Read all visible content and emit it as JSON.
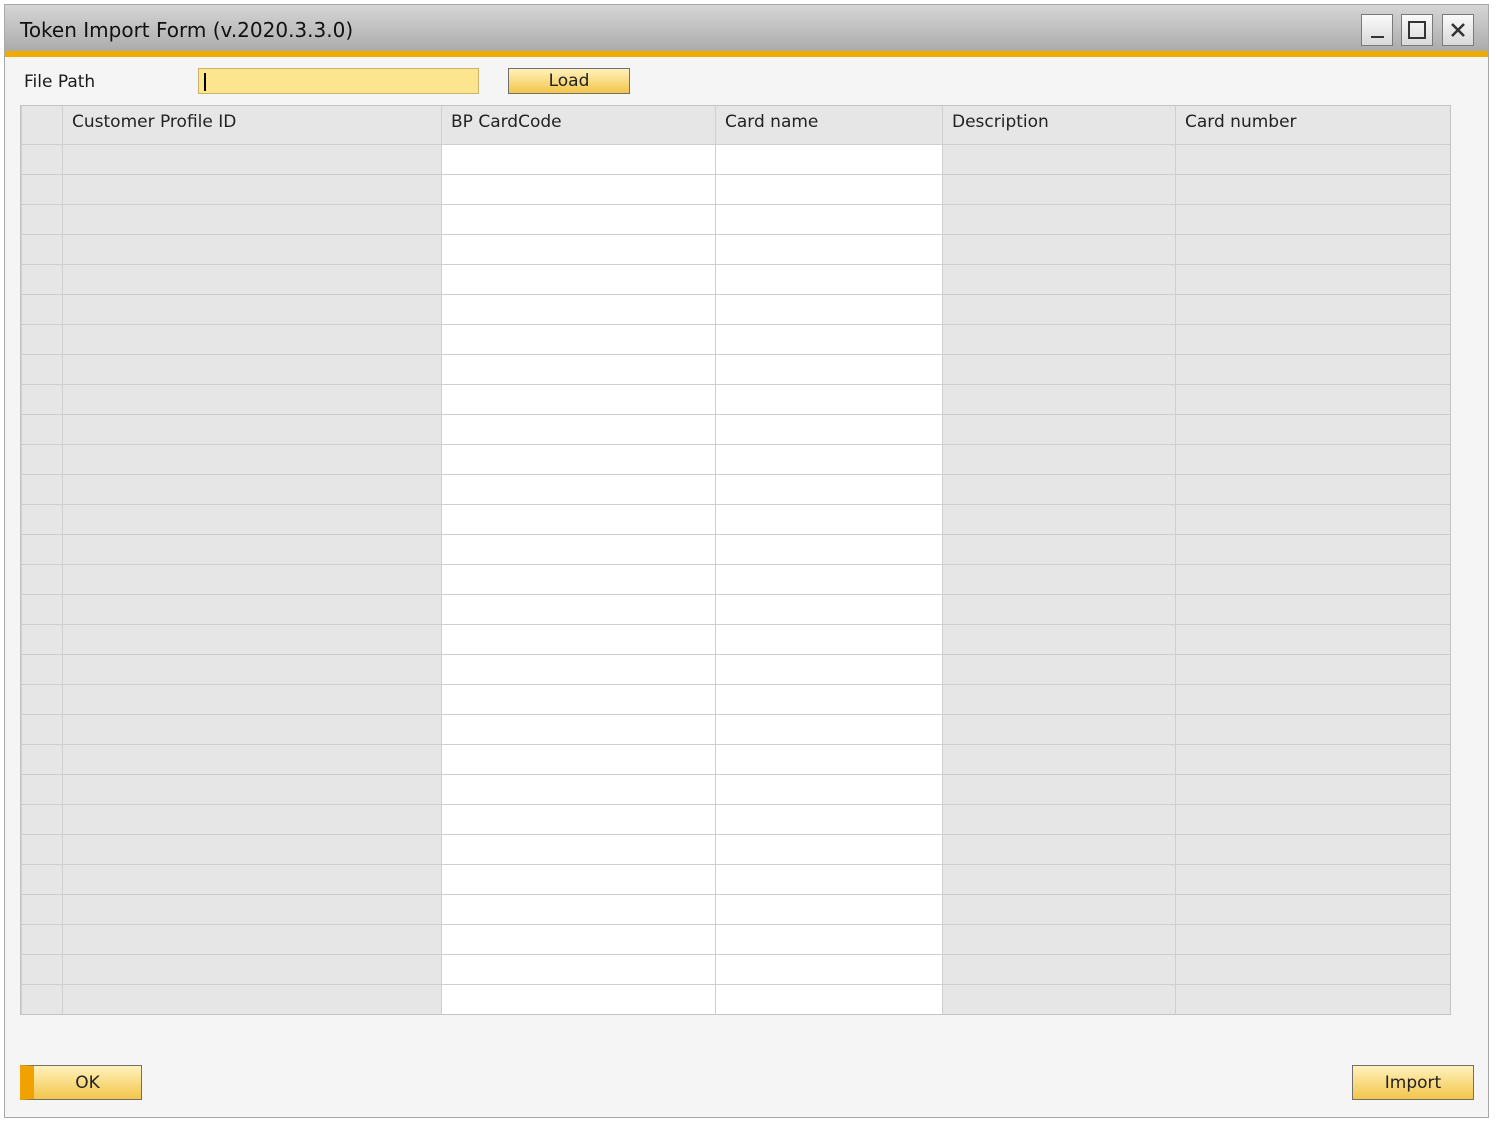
{
  "window": {
    "title": "Token Import Form (v.2020.3.3.0)"
  },
  "file_path": {
    "label": "File Path",
    "value": ""
  },
  "buttons": {
    "load": "Load",
    "ok": "OK",
    "import": "Import"
  },
  "grid": {
    "columns": [
      "Customer Profile ID",
      "BP CardCode",
      "Card name",
      "Description",
      "Card number"
    ],
    "editable_columns": [
      "BP CardCode",
      "Card name"
    ],
    "row_count": 29
  },
  "colors": {
    "accent": "#f0ab00",
    "field": "#fde58f",
    "grid": "#e6e6e6",
    "editable_cell": "#ffffff"
  }
}
